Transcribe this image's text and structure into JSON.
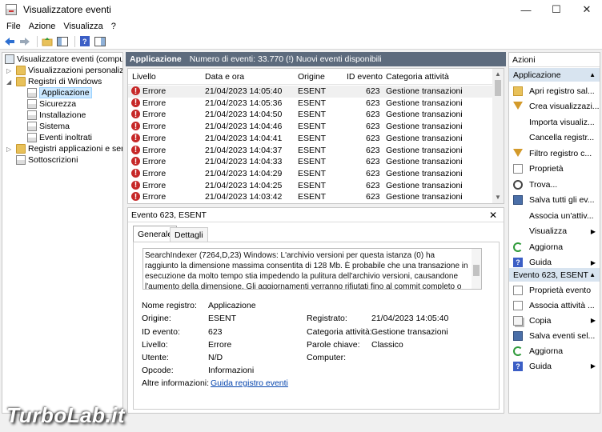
{
  "window": {
    "title": "Visualizzatore eventi"
  },
  "menu": [
    "File",
    "Azione",
    "Visualizza",
    "?"
  ],
  "tree": {
    "root": "Visualizzatore eventi (computer",
    "custom_views": "Visualizzazioni personalizzate",
    "windows_logs": "Registri di Windows",
    "logs": [
      "Applicazione",
      "Sicurezza",
      "Installazione",
      "Sistema",
      "Eventi inoltrati"
    ],
    "app_services": "Registri applicazioni e servizi",
    "subscriptions": "Sottoscrizioni"
  },
  "panel": {
    "name": "Applicazione",
    "info": "Numero di eventi: 33.770 (!) Nuovi eventi disponibili"
  },
  "columns": [
    "Livello",
    "Data e ora",
    "Origine",
    "ID evento",
    "Categoria attività"
  ],
  "events": [
    {
      "level": "Errore",
      "date": "21/04/2023 14:05:40",
      "source": "ESENT",
      "id": "623",
      "category": "Gestione transazioni"
    },
    {
      "level": "Errore",
      "date": "21/04/2023 14:05:36",
      "source": "ESENT",
      "id": "623",
      "category": "Gestione transazioni"
    },
    {
      "level": "Errore",
      "date": "21/04/2023 14:04:50",
      "source": "ESENT",
      "id": "623",
      "category": "Gestione transazioni"
    },
    {
      "level": "Errore",
      "date": "21/04/2023 14:04:46",
      "source": "ESENT",
      "id": "623",
      "category": "Gestione transazioni"
    },
    {
      "level": "Errore",
      "date": "21/04/2023 14:04:41",
      "source": "ESENT",
      "id": "623",
      "category": "Gestione transazioni"
    },
    {
      "level": "Errore",
      "date": "21/04/2023 14:04:37",
      "source": "ESENT",
      "id": "623",
      "category": "Gestione transazioni"
    },
    {
      "level": "Errore",
      "date": "21/04/2023 14:04:33",
      "source": "ESENT",
      "id": "623",
      "category": "Gestione transazioni"
    },
    {
      "level": "Errore",
      "date": "21/04/2023 14:04:29",
      "source": "ESENT",
      "id": "623",
      "category": "Gestione transazioni"
    },
    {
      "level": "Errore",
      "date": "21/04/2023 14:04:25",
      "source": "ESENT",
      "id": "623",
      "category": "Gestione transazioni"
    },
    {
      "level": "Errore",
      "date": "21/04/2023 14:03:42",
      "source": "ESENT",
      "id": "623",
      "category": "Gestione transazioni"
    }
  ],
  "detail": {
    "title": "Evento 623, ESENT",
    "tabs": [
      "Generale",
      "Dettagli"
    ],
    "description": "SearchIndexer (7264,D,23) Windows: L'archivio versioni per questa istanza (0) ha raggiunto la dimensione massima consentita di 128 Mb. È probabile che una transazione in esecuzione da molto tempo stia impedendo la pulitura dell'archivio versioni, causandone l'aumento della dimensione. Gli aggiornamenti verranno rifiutati fino al commit completo o all'annullamento",
    "fields": {
      "log_name_label": "Nome registro:",
      "log_name": "Applicazione",
      "source_label": "Origine:",
      "source": "ESENT",
      "logged_label": "Registrato:",
      "logged": "21/04/2023 14:05:40",
      "event_id_label": "ID evento:",
      "event_id": "623",
      "category_label": "Categoria attività:",
      "category": "Gestione transazioni",
      "level_label": "Livello:",
      "level": "Errore",
      "keywords_label": "Parole chiave:",
      "keywords": "Classico",
      "user_label": "Utente:",
      "user": "N/D",
      "computer_label": "Computer:",
      "computer": "",
      "opcode_label": "Opcode:",
      "opcode": "Informazioni",
      "more_info_label": "Altre informazioni:",
      "more_info_link": "Guida registro eventi"
    }
  },
  "actions": {
    "title": "Azioni",
    "section1": "Applicazione",
    "items1": [
      "Apri registro sal...",
      "Crea visualizzazi...",
      "Importa visualiz...",
      "Cancella registr...",
      "Filtro registro c...",
      "Proprietà",
      "Trova...",
      "Salva tutti gli ev...",
      "Associa un'attiv...",
      "Visualizza",
      "Aggiorna",
      "Guida"
    ],
    "section2": "Evento 623, ESENT",
    "items2": [
      "Proprietà evento",
      "Associa attività ...",
      "Copia",
      "Salva eventi sel...",
      "Aggiorna",
      "Guida"
    ]
  },
  "watermark": "TurboLab.it",
  "colors": {
    "panel_header": "#5d6b7d",
    "error": "#c62828",
    "section_bg": "#d8e4f0",
    "link": "#0645ad"
  }
}
